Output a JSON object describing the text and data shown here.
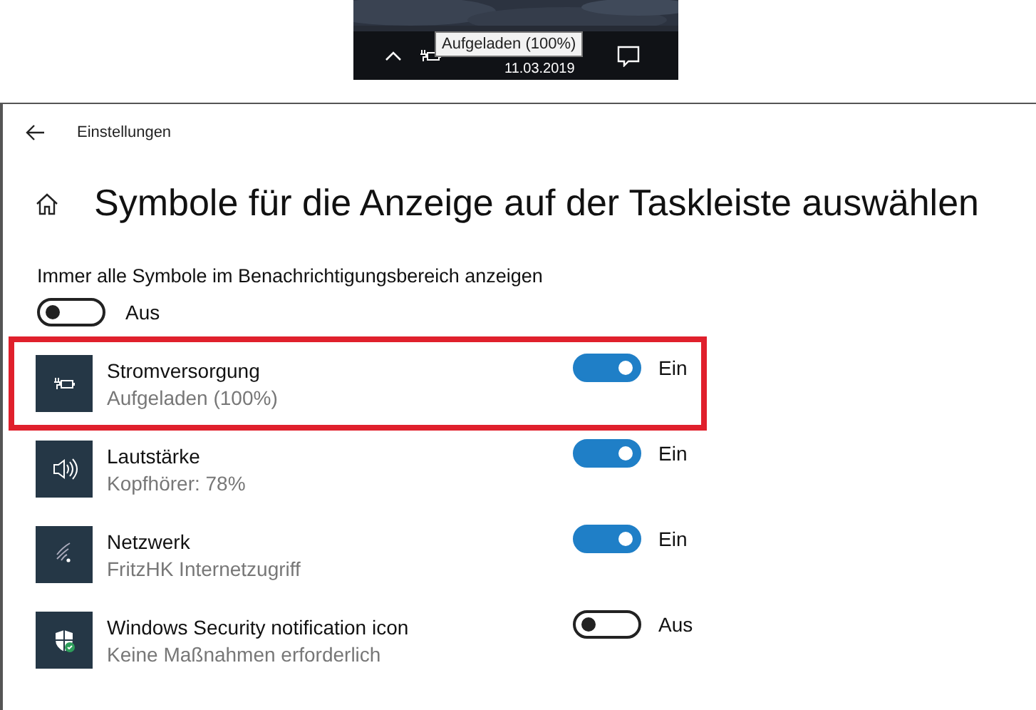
{
  "taskbar": {
    "tooltip": "Aufgeladen (100%)",
    "date": "11.03.2019"
  },
  "window": {
    "title": "Einstellungen"
  },
  "page": {
    "heading": "Symbole für die Anzeige auf der Taskleiste auswählen"
  },
  "always_show": {
    "label": "Immer alle Symbole im Benachrichtigungsbereich anzeigen",
    "on": false,
    "state_label": "Aus"
  },
  "items": [
    {
      "kind": "power",
      "name": "Stromversorgung",
      "status": "Aufgeladen (100%)",
      "on": true,
      "state_label": "Ein",
      "highlighted": true
    },
    {
      "kind": "volume",
      "name": "Lautstärke",
      "status": "Kopfhörer: 78%",
      "on": true,
      "state_label": "Ein",
      "highlighted": false
    },
    {
      "kind": "network",
      "name": "Netzwerk",
      "status": "FritzHK Internetzugriff",
      "on": true,
      "state_label": "Ein",
      "highlighted": false
    },
    {
      "kind": "security",
      "name": "Windows Security notification icon",
      "status": "Keine Maßnahmen erforderlich",
      "on": false,
      "state_label": "Aus",
      "highlighted": false
    }
  ]
}
